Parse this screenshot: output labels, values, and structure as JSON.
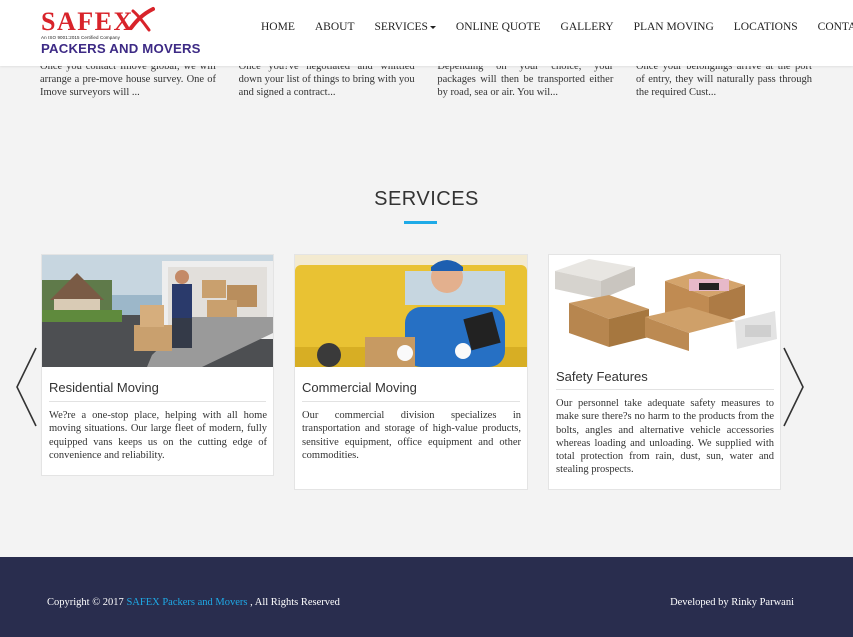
{
  "snippets": [
    "Once you contact Imove global, we will arrange a pre-move house survey. One of Imove surveyors will ...",
    "Once you?ve negotiated and whittled down your list of things to bring with you and signed a contract...",
    "Depending on your choice, your packages will then be transported either by road, sea or air. You wil...",
    "Once your belongings arrive at the port of entry, they will naturally pass through the required Cust..."
  ],
  "logo": {
    "name": "SAFEX",
    "certification": "An ISO 9001:2015 Certified Company",
    "subtitle": "PACKERS AND MOVERS",
    "brand_red": "#d8232a",
    "brand_purple": "#3d2a85"
  },
  "nav": {
    "items": [
      "HOME",
      "ABOUT",
      "SERVICES",
      "ONLINE QUOTE",
      "GALLERY",
      "PLAN MOVING",
      "LOCATIONS",
      "CONTACT"
    ]
  },
  "services": {
    "heading": "SERVICES",
    "accent": "#1eaae7",
    "cards": [
      {
        "title": "Residential Moving",
        "text": "We?re a one-stop place, helping with all home moving situations. Our large fleet of modern, fully equipped vans keeps us on the cutting edge of convenience and reliability.",
        "image": "mover-unloading-truck-photo"
      },
      {
        "title": "Commercial Moving",
        "text": "Our commercial division specializes in transportation and storage of high-value products, sensitive equipment, office equipment and other commodities.",
        "image": "courier-with-clipboard-photo"
      },
      {
        "title": "Safety Features",
        "text": "Our personnel take adequate safety measures to make sure there?s no harm to the products from the bolts, angles and alternative vehicle accessories whereas loading and unloading. We supplied with total protection from rain, dust, sun, water and stealing prospects.",
        "image": "packed-boxes-photo"
      }
    ],
    "prev_icon": "chevron-left-icon",
    "next_icon": "chevron-right-icon"
  },
  "footer": {
    "copyright_prefix": "Copyright © 2017 ",
    "copyright_link": "SAFEX Packers and Movers",
    "copyright_suffix": " , All Rights Reserved",
    "developed_by": "Developed by Rinky Parwani",
    "background": "#292d4e"
  }
}
